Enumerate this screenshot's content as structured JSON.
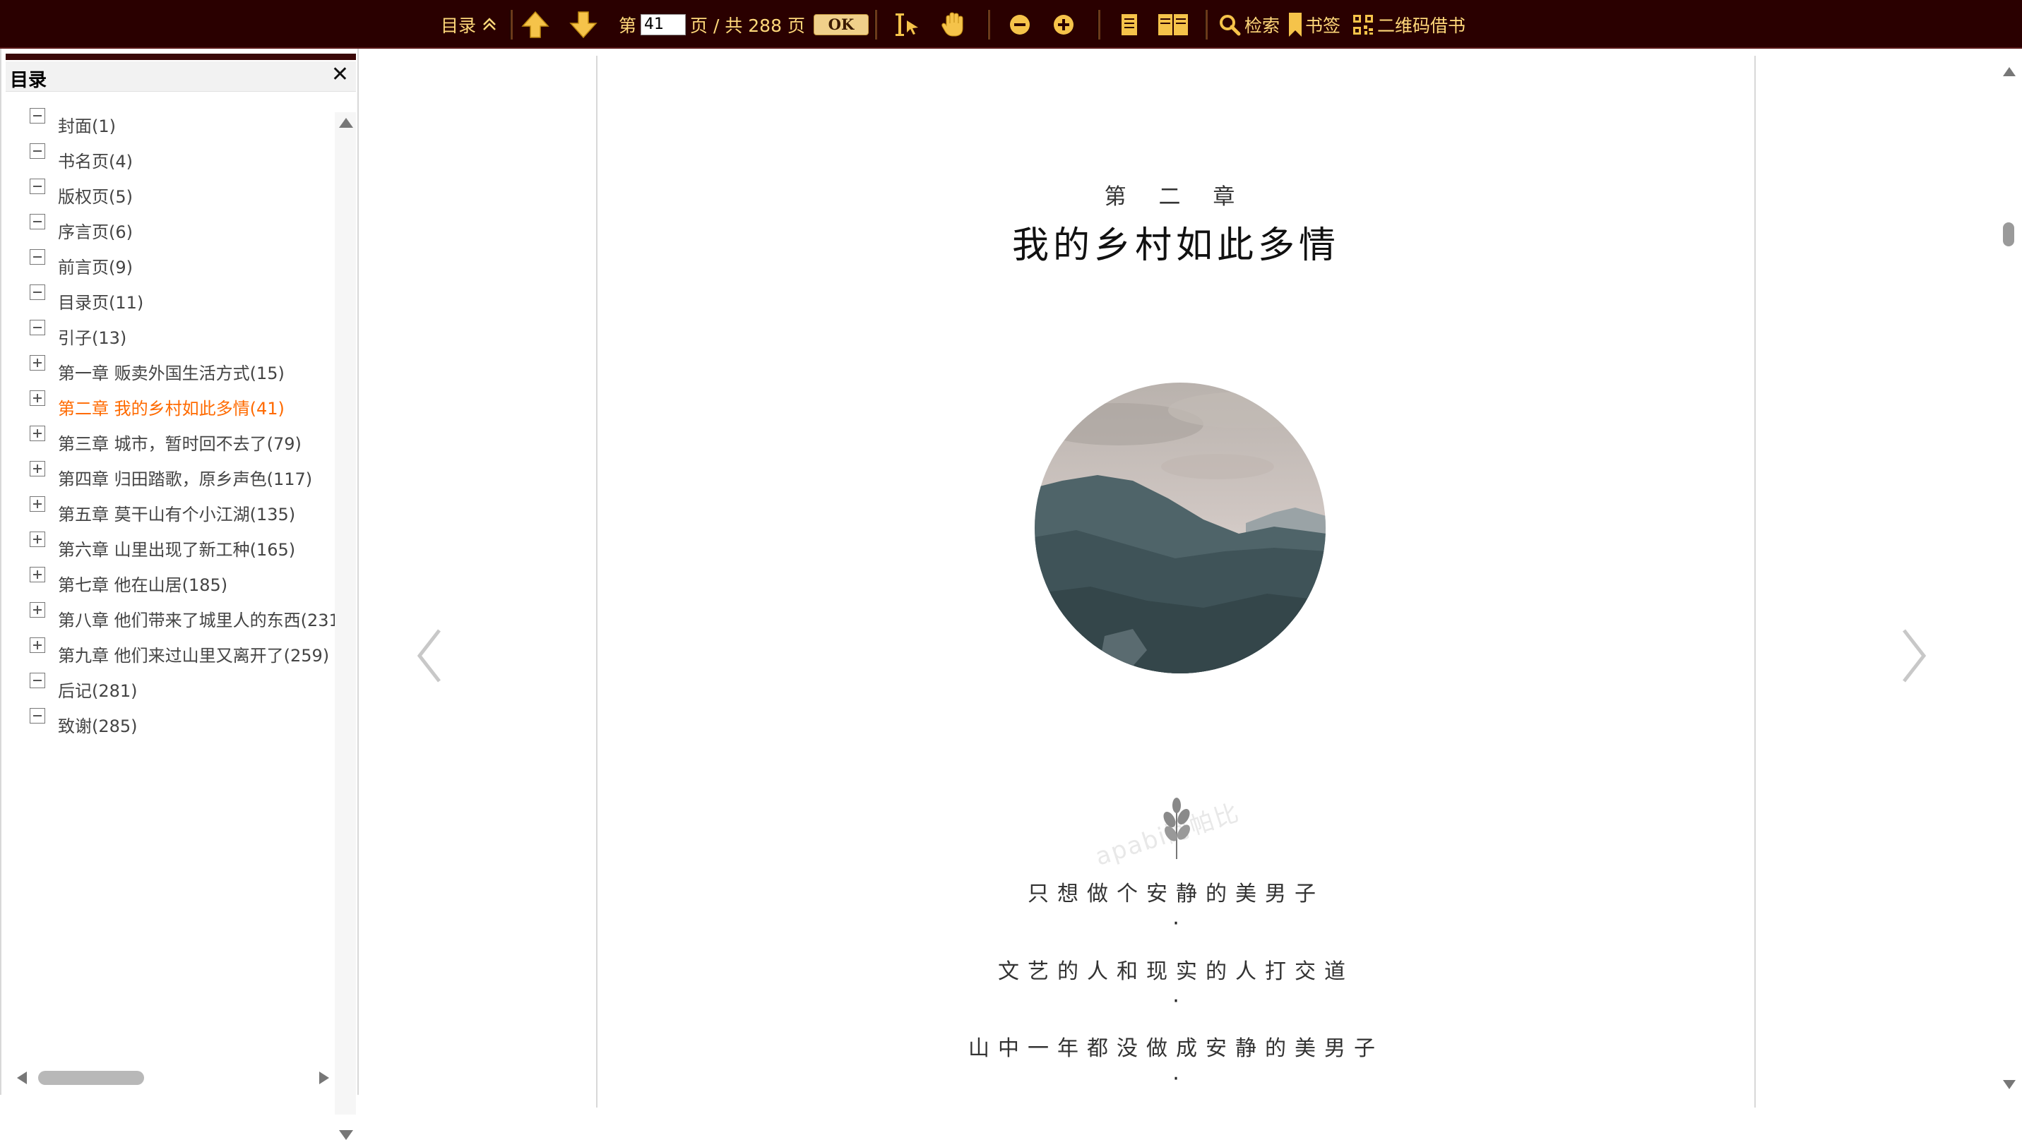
{
  "toolbar": {
    "toc_label": "目录",
    "page_prefix": "第",
    "current_page": "41",
    "page_suffix": "页 / 共 288 页",
    "ok_label": "OK",
    "search_label": "检索",
    "bookmark_label": "书签",
    "qrcode_label": "二维码借书",
    "colors": {
      "bar_bg": "#2a0000",
      "icon": "#ffd87a"
    }
  },
  "sidebar": {
    "title": "目录",
    "close_glyph": "✕",
    "items": [
      {
        "label": "封面(1)",
        "expand": "minus",
        "active": false
      },
      {
        "label": "书名页(4)",
        "expand": "minus",
        "active": false
      },
      {
        "label": "版权页(5)",
        "expand": "minus",
        "active": false
      },
      {
        "label": "序言页(6)",
        "expand": "minus",
        "active": false
      },
      {
        "label": "前言页(9)",
        "expand": "minus",
        "active": false
      },
      {
        "label": "目录页(11)",
        "expand": "minus",
        "active": false
      },
      {
        "label": "引子(13)",
        "expand": "minus",
        "active": false
      },
      {
        "label": "第一章 贩卖外国生活方式(15)",
        "expand": "plus",
        "active": false
      },
      {
        "label": "第二章 我的乡村如此多情(41)",
        "expand": "plus",
        "active": true
      },
      {
        "label": "第三章 城市，暂时回不去了(79)",
        "expand": "plus",
        "active": false
      },
      {
        "label": "第四章 归田踏歌，原乡声色(117)",
        "expand": "plus",
        "active": false
      },
      {
        "label": "第五章 莫干山有个小江湖(135)",
        "expand": "plus",
        "active": false
      },
      {
        "label": "第六章 山里出现了新工种(165)",
        "expand": "plus",
        "active": false
      },
      {
        "label": "第七章 他在山居(185)",
        "expand": "plus",
        "active": false
      },
      {
        "label": "第八章 他们带来了城里人的东西(231",
        "expand": "plus",
        "active": false
      },
      {
        "label": "第九章 他们来过山里又离开了(259)",
        "expand": "plus",
        "active": false
      },
      {
        "label": "后记(281)",
        "expand": "minus",
        "active": false
      },
      {
        "label": "致谢(285)",
        "expand": "minus",
        "active": false
      }
    ],
    "active_color": "#ff6a00"
  },
  "page": {
    "chapter_number": "第 二 章",
    "chapter_title": "我的乡村如此多情",
    "watermark": "apabi阿帕比",
    "poem": [
      "只想做个安静的美男子",
      "文艺的人和现实的人打交道",
      "山中一年都没做成安静的美男子"
    ],
    "dot": "·"
  }
}
